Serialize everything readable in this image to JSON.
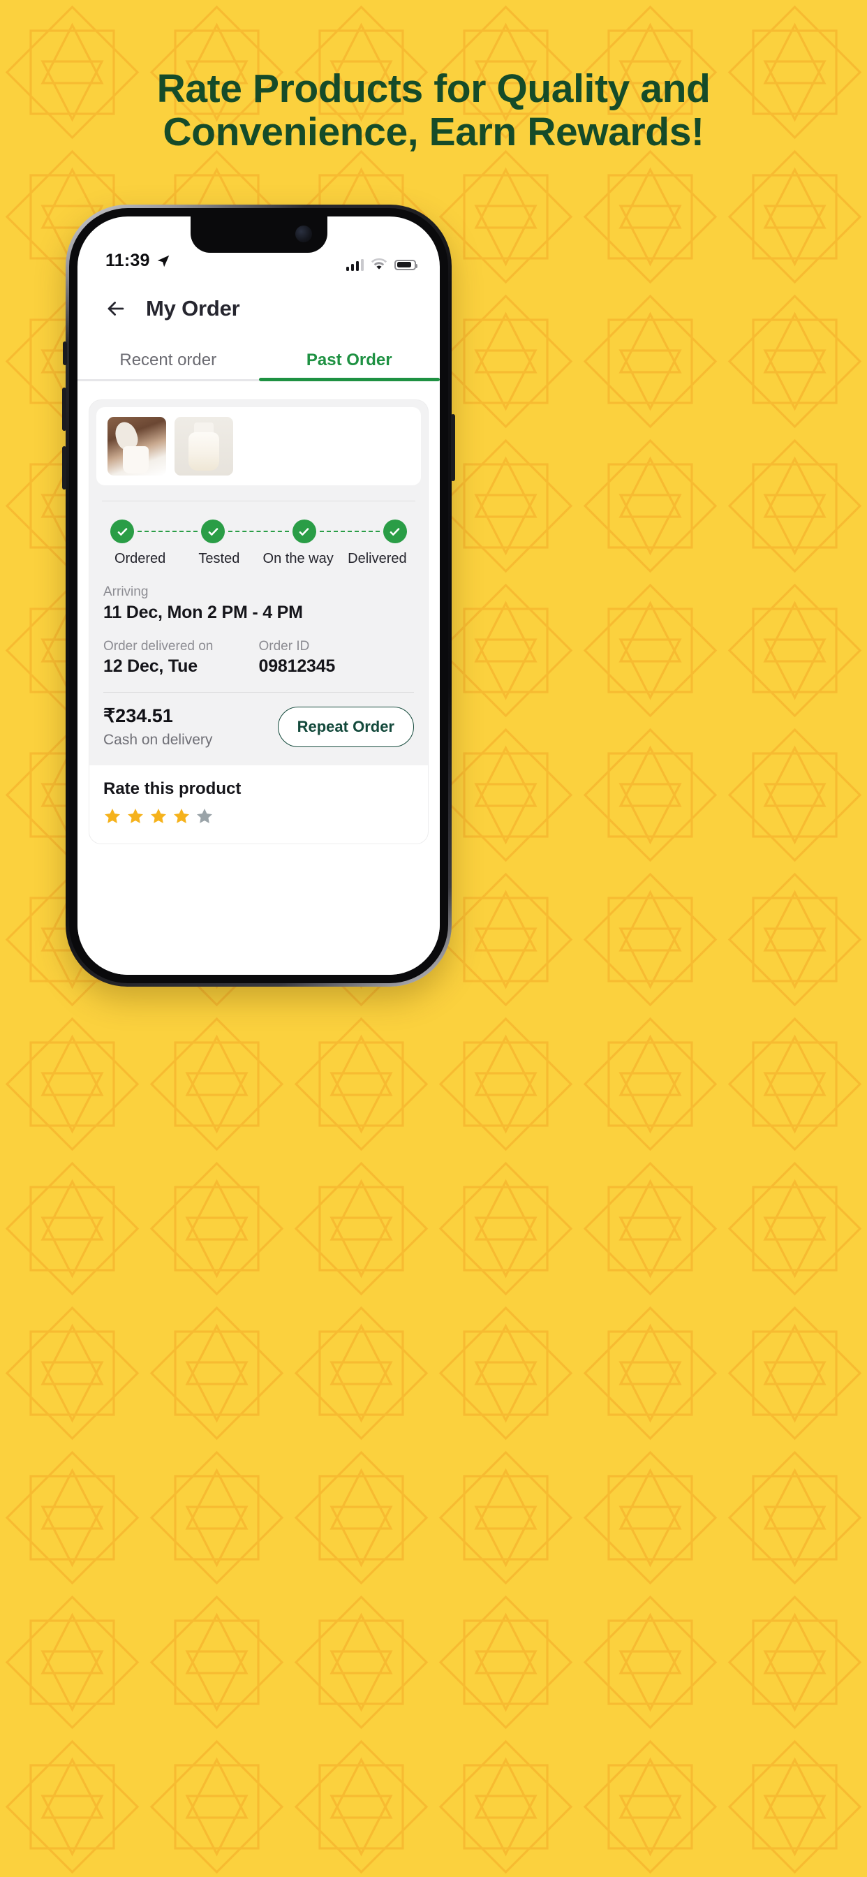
{
  "promo": {
    "headline_line1": "Rate Products for Quality and",
    "headline_line2": "Convenience, Earn Rewards!",
    "background_color": "#FBD13E",
    "headline_color": "#154B29",
    "pattern_color": "#F5A623"
  },
  "status_bar": {
    "time": "11:39",
    "location_icon": "location-arrow-icon",
    "signal_icon": "cellular-signal-icon",
    "wifi_icon": "wifi-icon",
    "battery_icon": "battery-icon",
    "signal_bars_filled": 3,
    "signal_bars_total": 4,
    "battery_level_percent": 86
  },
  "header": {
    "back_icon": "back-arrow-icon",
    "title": "My Order"
  },
  "tabs": [
    {
      "label": "Recent order",
      "active": false
    },
    {
      "label": "Past Order",
      "active": true
    }
  ],
  "order": {
    "thumbnails": [
      {
        "alt": "milk-pouring-into-glass"
      },
      {
        "alt": "milk-bottle"
      }
    ],
    "tracker": {
      "steps": [
        {
          "label": "Ordered",
          "completed": true
        },
        {
          "label": "Tested",
          "completed": true
        },
        {
          "label": "On the way",
          "completed": true
        },
        {
          "label": "Delivered",
          "completed": true
        }
      ],
      "check_icon": "check-icon",
      "accent_color": "#2A9D46"
    },
    "arriving_label": "Arriving",
    "arriving_value": "11 Dec, Mon 2 PM - 4 PM",
    "delivered_label": "Order delivered on",
    "delivered_value": "12 Dec, Tue",
    "order_id_label": "Order ID",
    "order_id_value": "09812345",
    "price": "₹234.51",
    "payment_mode": "Cash on delivery",
    "repeat_button": "Repeat Order",
    "repeat_button_color": "#13493B"
  },
  "rating": {
    "title": "Rate this product",
    "stars_filled": 4,
    "stars_total": 5,
    "star_icon": "star-icon",
    "filled_color": "#F5B21C",
    "empty_color": "#9AA3A8"
  }
}
